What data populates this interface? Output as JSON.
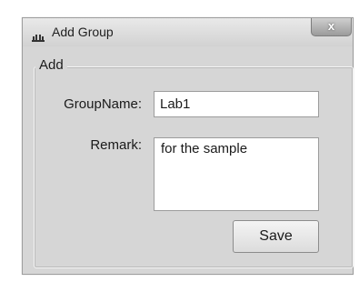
{
  "window": {
    "title": "Add Group",
    "close_glyph": "x",
    "app_icon": "network-icon"
  },
  "group": {
    "legend": "Add"
  },
  "form": {
    "groupname_label": "GroupName:",
    "groupname_value": "Lab1",
    "remark_label": "Remark:",
    "remark_value": "for the sample",
    "save_label": "Save"
  }
}
